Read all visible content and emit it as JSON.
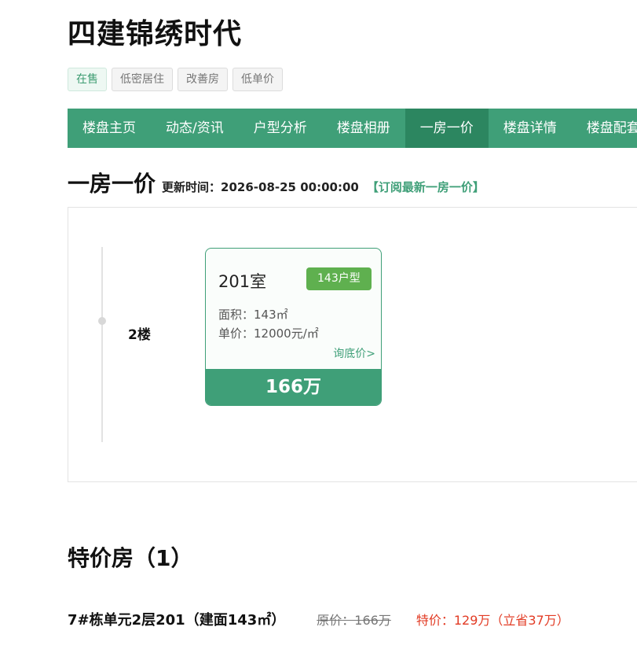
{
  "project": {
    "title": "四建锦绣时代"
  },
  "tags": [
    "在售",
    "低密居住",
    "改善房",
    "低单价"
  ],
  "nav": {
    "items": [
      "楼盘主页",
      "动态/资讯",
      "户型分析",
      "楼盘相册",
      "一房一价",
      "楼盘详情",
      "楼盘配套"
    ],
    "active_index": 4
  },
  "price_list": {
    "title": "一房一价",
    "update_label": "更新时间：",
    "update_time": "2026-08-25 00:00:00",
    "subscribe_link": "【订阅最新一房一价】",
    "floor": "2楼",
    "unit": {
      "room": "201室",
      "type": "143户型",
      "area": "面积：143㎡",
      "unit_price": "单价：12000元/㎡",
      "ask_link": "询底价>",
      "total": "166万"
    }
  },
  "special": {
    "title": "特价房（1）",
    "item": {
      "name": "7#栋单元2层201（建面143㎡）",
      "original_price": "原价：166万",
      "special_price": "特价：129万（立省37万）"
    }
  },
  "colors": {
    "brand_green": "#3f9f78",
    "nav_active": "#2c8660",
    "type_badge": "#5fb04f",
    "special_red": "#e23b24"
  }
}
